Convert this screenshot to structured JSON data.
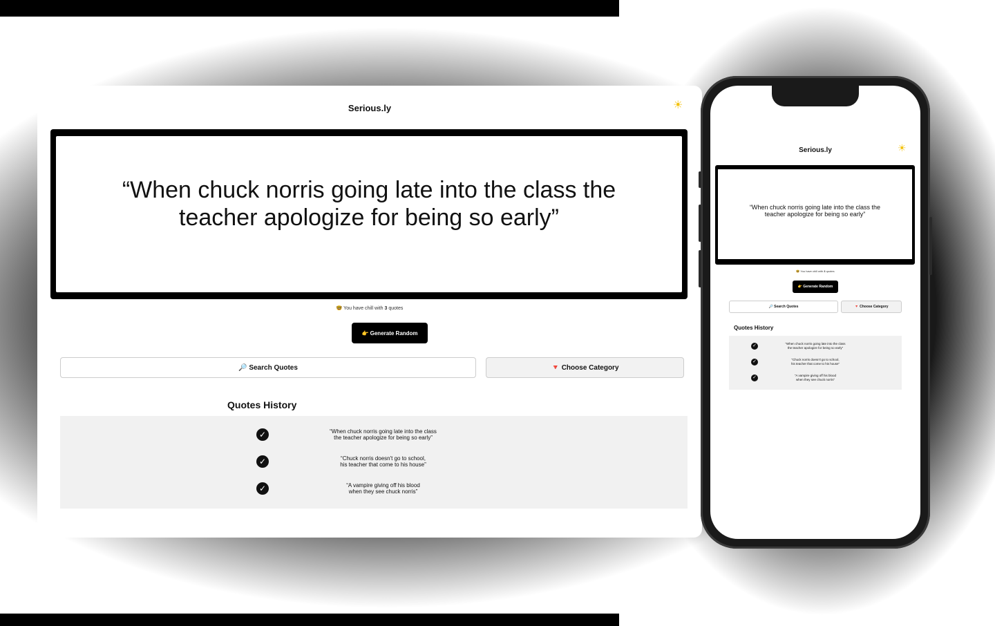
{
  "app": {
    "brand": "Serious.ly",
    "theme_icon": "sun-icon"
  },
  "quote": {
    "text": "“When chuck norris going late into the class the teacher apologize for being so early”"
  },
  "counter": {
    "emoji": "🤓",
    "prefix": "You have chill with",
    "count": "3",
    "suffix": "quotes"
  },
  "actions": {
    "generate_label": "👉 Generate Random",
    "search_label": "🔎 Search Quotes",
    "category_label": "🔻 Choose Category"
  },
  "history": {
    "title": "Quotes History",
    "items": [
      {
        "line1": "“When chuck norris going late into the class",
        "line2": "the teacher apologize for being so early”"
      },
      {
        "line1": "“Chuck norris doesn't go to school,",
        "line2": "his teacher that come to his house”"
      },
      {
        "line1": "“A vampire giving off his blood",
        "line2": "when they see chuck norris”"
      }
    ]
  },
  "colors": {
    "accent": "#000000",
    "sun": "#f4c20d",
    "history_bg": "#f1f1f1"
  }
}
